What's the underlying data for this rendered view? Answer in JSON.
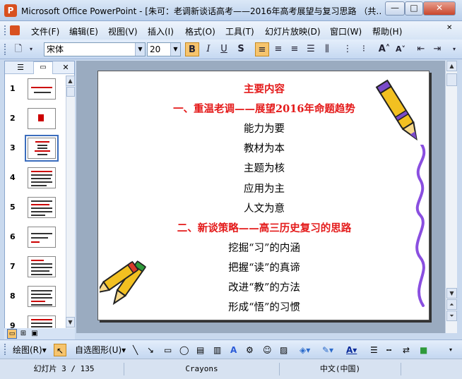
{
  "window": {
    "title": "Microsoft Office PowerPoint - [朱可：老调新谈话高考——2016年高考展望与复习思路 （共…",
    "min": "—",
    "max": "□",
    "close": "✕",
    "app_glyph": "P"
  },
  "menu": [
    "文件(F)",
    "编辑(E)",
    "视图(V)",
    "插入(I)",
    "格式(O)",
    "工具(T)",
    "幻灯片放映(D)",
    "窗口(W)",
    "帮助(H)"
  ],
  "toolbar": {
    "font": "宋体",
    "size": "20",
    "bold": "B",
    "italic": "I",
    "underline": "U",
    "shadow": "S",
    "inc_font": "A˄",
    "dec_font": "A˅"
  },
  "thumbnails": [
    "1",
    "2",
    "3",
    "4",
    "5",
    "6",
    "7",
    "8",
    "9"
  ],
  "selected_thumbnail": "3",
  "slide": {
    "heading": "主要内容",
    "section1": "一、重温老调——展望2016年命题趋势",
    "items1": [
      "能力为要",
      "教材为本",
      "主题为核",
      "应用为主",
      "人文为意"
    ],
    "section2": "二、新谈策略——高三历史复习的思路",
    "items2": [
      "挖掘“习”的内涵",
      "把握“读”的真谛",
      "改进“教”的方法",
      "形成“悟”的习惯"
    ]
  },
  "drawbar": {
    "draw": "绘图(R)▾",
    "autoshapes": "自选图形(U)▾"
  },
  "status": {
    "slide": "幻灯片 3 / 135",
    "design": "Crayons",
    "language": "中文(中国)"
  },
  "colors": {
    "accent_red": "#e41a1a",
    "bold_active": "#f6c46d"
  }
}
